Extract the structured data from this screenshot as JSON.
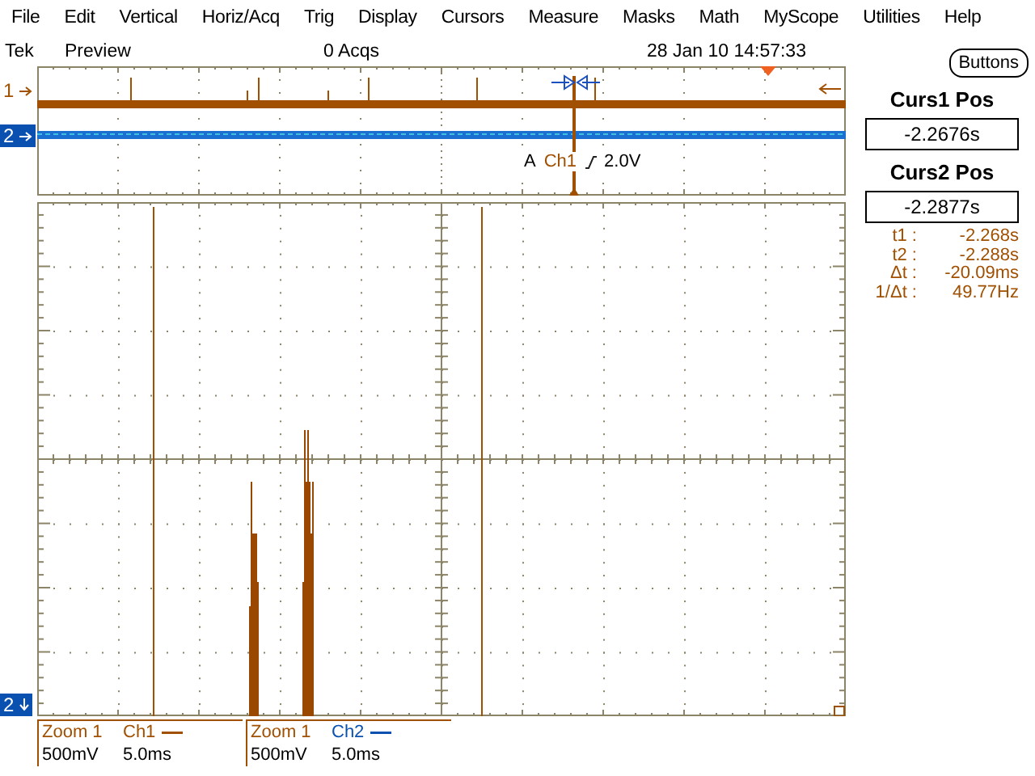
{
  "menu": [
    "File",
    "Edit",
    "Vertical",
    "Horiz/Acq",
    "Trig",
    "Display",
    "Cursors",
    "Measure",
    "Masks",
    "Math",
    "MyScope",
    "Utilities",
    "Help"
  ],
  "status_bar": {
    "brand": "Tek",
    "mode": "Preview",
    "acquisitions": "0 Acqs",
    "datetime": "28 Jan 10 14:57:33"
  },
  "buttons_button": "Buttons",
  "overview": {
    "channel_markers": [
      {
        "label": "1",
        "color": "#a05000"
      },
      {
        "label": "2",
        "color": "#0a50b0"
      }
    ],
    "trigger": {
      "source_prefix": "A",
      "channel": "Ch1",
      "level": "2.0V"
    }
  },
  "main_display": {
    "channel_markers": [
      {
        "label": "2",
        "color": "#0a50b0"
      }
    ]
  },
  "cursor_panel": {
    "positions": [
      {
        "title": "Curs1 Pos",
        "value": "-2.2676s"
      },
      {
        "title": "Curs2 Pos",
        "value": "-2.2877s"
      }
    ],
    "readouts": [
      {
        "label": "t1 :",
        "value": "-2.268s"
      },
      {
        "label": "t2 :",
        "value": "-2.288s"
      },
      {
        "label": "Δt :",
        "value": "-20.09ms"
      },
      {
        "label": "1/Δt :",
        "value": "49.77Hz"
      }
    ]
  },
  "channel_readouts": [
    {
      "title": "Zoom 1",
      "channel": "Ch1",
      "color": "#a05000",
      "scale": "500mV",
      "timebase": "5.0ms"
    },
    {
      "title": "Zoom 1",
      "channel": "Ch2",
      "color": "#0a50b0",
      "scale": "500mV",
      "timebase": "5.0ms"
    }
  ]
}
